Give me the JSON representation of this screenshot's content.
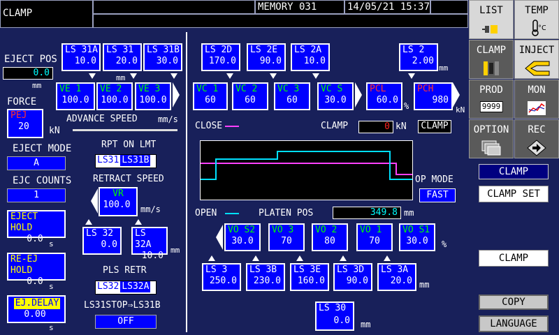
{
  "header": {
    "title": "CLAMP",
    "memory": "MEMORY 031",
    "datetime": "14/05/21 15:37"
  },
  "left": {
    "eject_pos": {
      "label": "EJECT POS",
      "value": "0.0",
      "unit": "mm"
    },
    "force": {
      "label": "FORCE",
      "tag": "PEJ",
      "value": "20",
      "unit": "kN"
    },
    "eject_mode": {
      "label": "EJECT MODE",
      "value": "A"
    },
    "ejc_counts": {
      "label": "EJC COUNTS",
      "value": "1"
    },
    "eject_hold": {
      "label": "EJECT HOLD",
      "value": "0.0",
      "unit": "s"
    },
    "re_ej_hold": {
      "label": "RE-EJ HOLD",
      "value": "0.0",
      "unit": "s"
    },
    "ej_delay": {
      "label": "EJ.DELAY",
      "value": "0.00",
      "unit": "s"
    }
  },
  "ls_top": [
    {
      "name": "LS 31A",
      "value": "10.0"
    },
    {
      "name": "LS 31",
      "value": "20.0"
    },
    {
      "name": "LS 31B",
      "value": "30.0"
    }
  ],
  "ls_top_unit": "mm",
  "ve": [
    {
      "name": "VE 1",
      "value": "100.0"
    },
    {
      "name": "VE 2",
      "value": "100.0"
    },
    {
      "name": "VE 3",
      "value": "100.0"
    }
  ],
  "advance_speed": {
    "label": "ADVANCE SPEED",
    "unit": "mm/s"
  },
  "rpt_on_lmt": {
    "label": "RPT ON LMT",
    "opt1": "LS31",
    "opt2": "LS31B"
  },
  "retract_speed": {
    "label": "RETRACT SPEED",
    "tag": "VR",
    "value": "100.0",
    "unit": "mm/s"
  },
  "ls_retract": [
    {
      "name": "LS 32",
      "value": "0.0"
    },
    {
      "name": "LS 32A",
      "value": "10.0"
    }
  ],
  "ls_retract_unit": "mm",
  "pls_retr": {
    "label": "PLS RETR",
    "opt1": "LS32",
    "opt2": "LS32A"
  },
  "ls31stop": {
    "label": "LS31STOP⇒LS31B",
    "value": "OFF"
  },
  "clamp_ls": [
    {
      "name": "LS 2D",
      "value": "170.0"
    },
    {
      "name": "LS 2E",
      "value": "90.0"
    },
    {
      "name": "LS 2A",
      "value": "10.0"
    }
  ],
  "ls2": {
    "name": "LS 2",
    "value": "2.00",
    "unit": "mm"
  },
  "vc": [
    {
      "name": "VC 1",
      "value": "60"
    },
    {
      "name": "VC 2",
      "value": "60"
    },
    {
      "name": "VC 3",
      "value": "60"
    },
    {
      "name": "VC S",
      "value": "30.0"
    }
  ],
  "pcl": {
    "name": "PCL",
    "value": "60.0",
    "unit": "%"
  },
  "pch": {
    "name": "PCH",
    "value": "980",
    "unit": "kN"
  },
  "close_label": "CLOSE",
  "clamp_readout": {
    "label": "CLAMP",
    "value": "0",
    "unit": "kN",
    "status": "CLAMP"
  },
  "op_mode": {
    "label": "OP MODE",
    "value": "FAST"
  },
  "open_label": "OPEN",
  "platen_pos": {
    "label": "PLATEN POS",
    "value": "349.8",
    "unit": "mm"
  },
  "vo": [
    {
      "name": "VO S2",
      "value": "30.0"
    },
    {
      "name": "VO 3",
      "value": "70"
    },
    {
      "name": "VO 2",
      "value": "80"
    },
    {
      "name": "VO 1",
      "value": "70"
    },
    {
      "name": "VO S1",
      "value": "30.0"
    }
  ],
  "vo_unit": "%",
  "open_ls": [
    {
      "name": "LS 3",
      "value": "250.0"
    },
    {
      "name": "LS 3B",
      "value": "230.0"
    },
    {
      "name": "LS 3E",
      "value": "160.0"
    },
    {
      "name": "LS 3D",
      "value": "90.0"
    },
    {
      "name": "LS 3A",
      "value": "20.0"
    }
  ],
  "open_ls_unit": "mm",
  "ls30": {
    "name": "LS 30",
    "value": "0.0",
    "unit": "mm"
  },
  "sidebar": {
    "list": "LIST",
    "temp": "TEMP",
    "clamp": "CLAMP",
    "inject": "INJECT",
    "prod": "PROD",
    "prod_count": "9999",
    "mon": "MON",
    "option": "OPTION",
    "rec": "REC"
  },
  "right_buttons": {
    "clamp_header": "CLAMP",
    "clamp_set": "CLAMP SET",
    "clamp2": "CLAMP",
    "copy": "COPY",
    "language": "LANGUAGE"
  },
  "colors": {
    "bg": "#18205a",
    "panel_blue": "#0000ff",
    "close_line": "#ff40ff",
    "open_line": "#00e0ff"
  }
}
